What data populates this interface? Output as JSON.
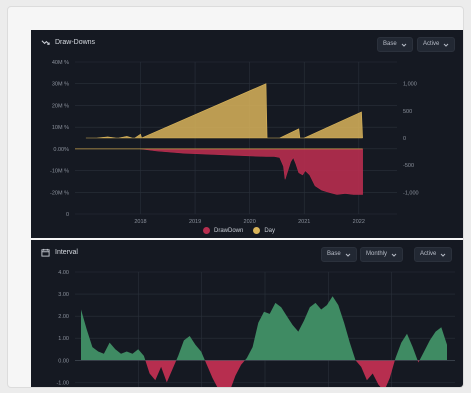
{
  "colors": {
    "panel_bg": "#151922",
    "drawdown": "#b72e4f",
    "day": "#d9b45a",
    "interval_positive": "#3f8b63",
    "interval_negative": "#b72e4f",
    "grid": "#2a313b"
  },
  "top_panel": {
    "title": "Draw-Downs",
    "title_icon": "trend-down-icon",
    "dropdowns": [
      {
        "label": "Base",
        "icon": "chevron-down-icon"
      },
      {
        "label": "Active",
        "icon": "chevron-down-icon"
      }
    ],
    "legend": [
      {
        "label": "DrawDown",
        "color": "#b72e4f"
      },
      {
        "label": "Day",
        "color": "#d9b45a"
      }
    ]
  },
  "bottom_panel": {
    "title": "Interval",
    "title_icon": "calendar-icon",
    "dropdowns": [
      {
        "label": "Base",
        "icon": "chevron-down-icon"
      },
      {
        "label": "Monthly",
        "icon": "chevron-down-icon"
      },
      {
        "label": "Active",
        "icon": "chevron-down-icon"
      }
    ]
  },
  "chart_data": [
    {
      "type": "area",
      "title": "Draw-Downs",
      "left_axis": {
        "ticks": [
          "40M %",
          "30M %",
          "20M %",
          "10M %",
          "0.00%",
          "-10M %",
          "-20M %",
          "0"
        ],
        "range": [
          -30,
          40
        ]
      },
      "right_axis": {
        "ticks": [
          "1,000",
          "500",
          "0",
          "-500",
          "-1,000"
        ],
        "range": [
          -1400,
          1400
        ]
      },
      "x_ticks": [
        "2018",
        "2019",
        "2020",
        "2021",
        "2022"
      ],
      "x_range": [
        2016.8,
        2022.7
      ],
      "grid": true,
      "legend_position": "bottom-center",
      "series": [
        {
          "name": "Day",
          "axis": "right",
          "points": [
            [
              2017.0,
              0
            ],
            [
              2017.2,
              0
            ],
            [
              2017.4,
              20
            ],
            [
              2017.55,
              0
            ],
            [
              2017.6,
              0
            ],
            [
              2017.75,
              30
            ],
            [
              2017.85,
              0
            ],
            [
              2017.9,
              0
            ],
            [
              2018.0,
              70
            ],
            [
              2018.02,
              0
            ],
            [
              2020.3,
              1000
            ],
            [
              2020.32,
              0
            ],
            [
              2020.55,
              0
            ],
            [
              2020.9,
              170
            ],
            [
              2020.92,
              0
            ],
            [
              2021.0,
              0
            ],
            [
              2022.05,
              480
            ],
            [
              2022.07,
              0
            ]
          ]
        },
        {
          "name": "DrawDown",
          "axis": "left",
          "points": [
            [
              2018.0,
              0
            ],
            [
              2018.3,
              -1
            ],
            [
              2018.8,
              -2
            ],
            [
              2019.3,
              -2.5
            ],
            [
              2019.8,
              -3
            ],
            [
              2020.3,
              -3.5
            ],
            [
              2020.45,
              -3.5
            ],
            [
              2020.55,
              -4
            ],
            [
              2020.62,
              -8
            ],
            [
              2020.65,
              -14
            ],
            [
              2020.7,
              -10
            ],
            [
              2020.75,
              -6
            ],
            [
              2020.8,
              -4
            ],
            [
              2020.85,
              -7
            ],
            [
              2020.9,
              -11
            ],
            [
              2020.97,
              -12
            ],
            [
              2021.02,
              -10
            ],
            [
              2021.1,
              -12
            ],
            [
              2021.2,
              -17
            ],
            [
              2021.32,
              -19
            ],
            [
              2021.45,
              -20
            ],
            [
              2021.6,
              -21
            ],
            [
              2021.75,
              -20.5
            ],
            [
              2021.9,
              -21
            ],
            [
              2022.07,
              -21
            ],
            [
              2022.07,
              0
            ]
          ]
        }
      ]
    },
    {
      "type": "area",
      "title": "Interval",
      "y_ticks": [
        "4.00",
        "3.00",
        "2.00",
        "1.00",
        "0.00",
        "-1.00"
      ],
      "y_range": [
        -1.3,
        4
      ],
      "grid": true,
      "series": [
        {
          "name": "",
          "values": [
            2.3,
            1.4,
            0.6,
            0.4,
            0.3,
            0.8,
            0.5,
            0.3,
            0.4,
            0.3,
            0.5,
            0.2,
            -0.6,
            -0.9,
            -0.3,
            -1.0,
            -0.4,
            0.2,
            0.9,
            1.1,
            0.7,
            0.4,
            -0.2,
            -0.8,
            -1.3,
            -1.6,
            -1.4,
            -0.7,
            -0.2,
            0.1,
            0.6,
            1.7,
            2.2,
            2.1,
            2.6,
            2.4,
            2.0,
            1.6,
            1.3,
            1.8,
            2.4,
            2.6,
            2.3,
            2.5,
            2.9,
            2.5,
            1.7,
            0.8,
            0.0,
            -0.3,
            -0.9,
            -0.6,
            -1.1,
            -1.4,
            -0.8,
            0.1,
            0.8,
            1.2,
            0.6,
            -0.1,
            0.4,
            0.9,
            1.3,
            1.5,
            0.7
          ]
        }
      ]
    }
  ]
}
